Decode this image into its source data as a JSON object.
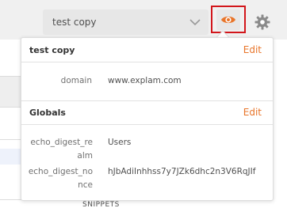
{
  "environment": {
    "selected": "test copy"
  },
  "quicklook": {
    "environment_section": {
      "title": "test copy",
      "edit_label": "Edit",
      "variables": [
        {
          "key": "domain",
          "value": "www.explam.com"
        }
      ]
    },
    "globals_section": {
      "title": "Globals",
      "edit_label": "Edit",
      "variables": [
        {
          "key": "echo_digest_realm",
          "value": "Users"
        },
        {
          "key": "echo_digest_nonce",
          "value": "hJbAdiInhhss7y7JZk6dhc2n3V6RqJIf"
        }
      ]
    }
  },
  "background": {
    "snippets_label": "SNIPPETS"
  },
  "colors": {
    "accent_orange": "#e8752a",
    "highlight_red": "#d2161b",
    "selector_bg": "#e7e7e7"
  },
  "icons": [
    "chevron-down-icon",
    "eye-icon",
    "gear-icon"
  ]
}
